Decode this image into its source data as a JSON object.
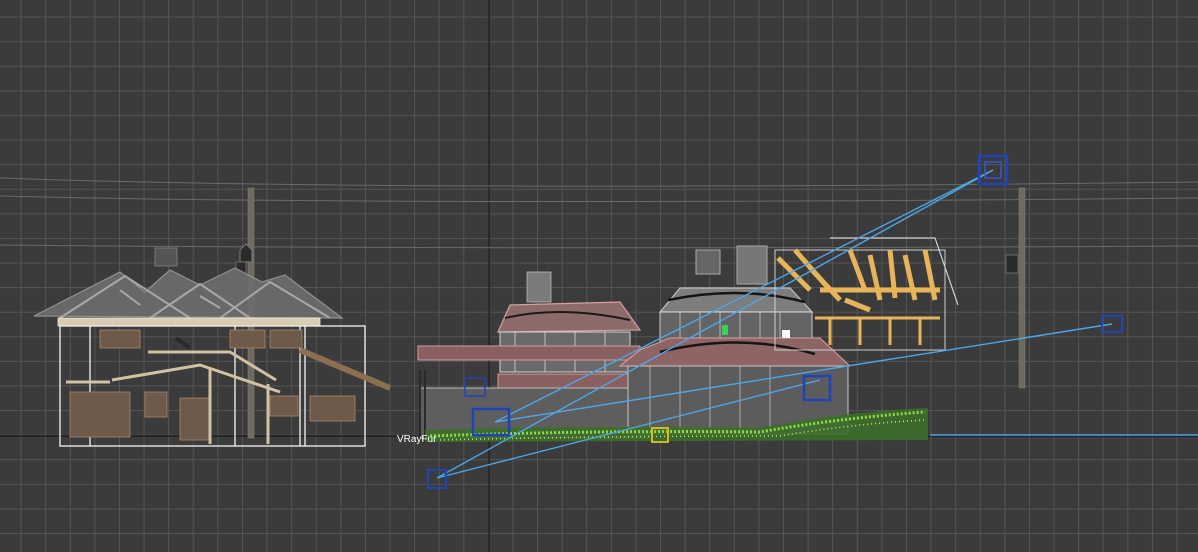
{
  "viewport": {
    "selected_object_label": "VRayFur"
  },
  "icons": {
    "camera": "camera-icon",
    "target": "camera-target-icon",
    "light": "light-icon",
    "helper": "helper-icon"
  },
  "colors": {
    "grid_background": "#3b3b3b",
    "grid_line": "#555555",
    "world_axis": "#111111",
    "camera_line": "#4da6e8",
    "camera_icon": "#1f43b8",
    "helper_yellow": "#e4c21a",
    "frame_wood": "#e8b45a",
    "wireframe_white": "#e8e8e8",
    "roof_gray": "#8a8a8a",
    "roof_red": "#b06a6a",
    "grass": "#7cc23a"
  }
}
